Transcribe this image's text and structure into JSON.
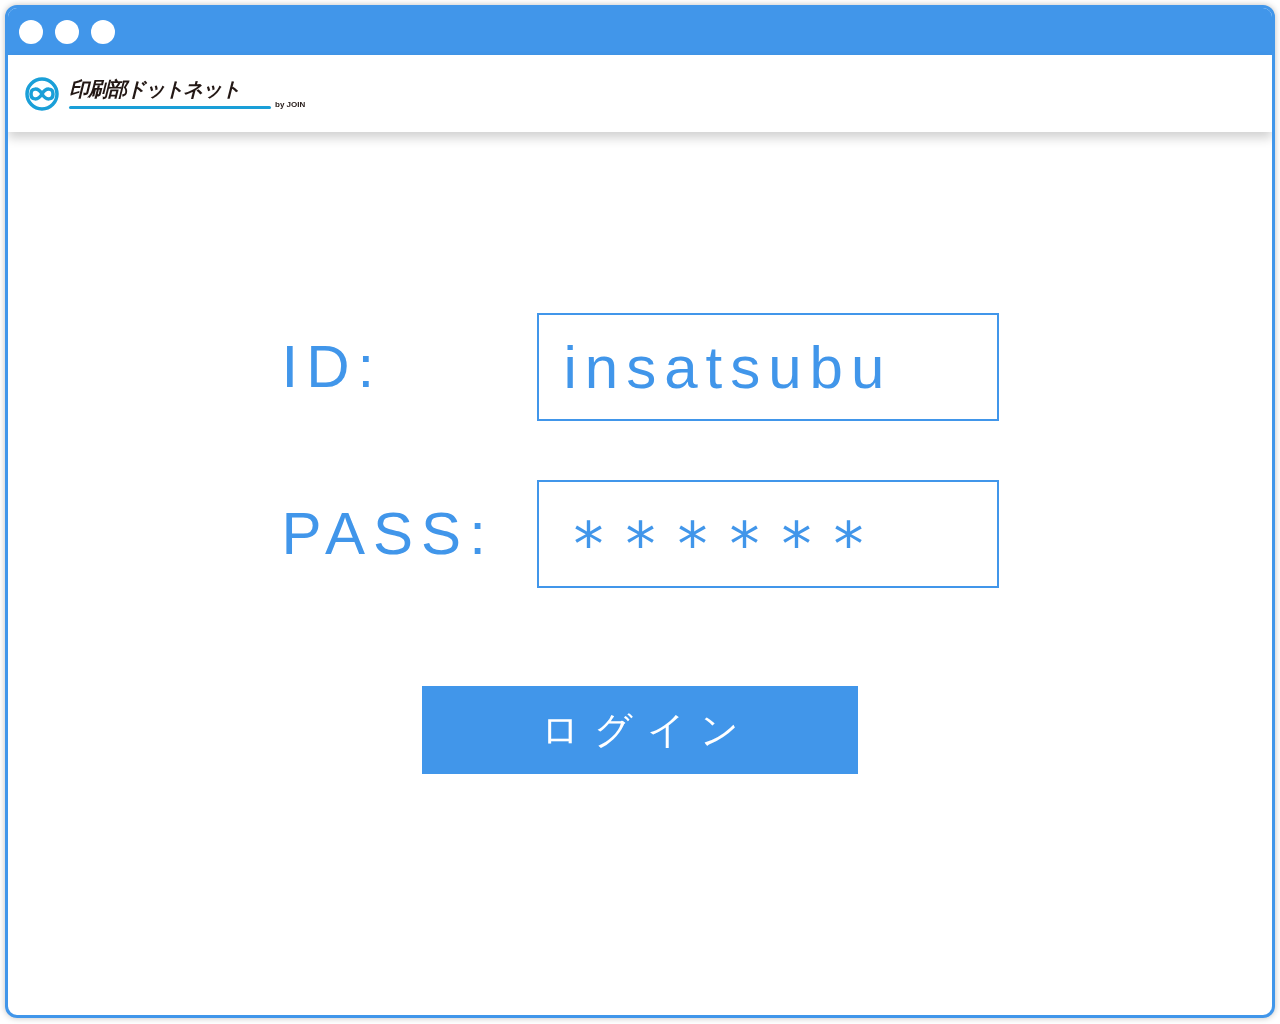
{
  "header": {
    "logo": {
      "title": "印刷部ドットネット",
      "subtitle": "by JOIN"
    }
  },
  "form": {
    "fields": [
      {
        "label": "ID:",
        "value": "insatsubu",
        "kind": "text"
      },
      {
        "label": "PASS:",
        "value": "******",
        "kind": "password"
      }
    ],
    "submit": "ログイン"
  }
}
